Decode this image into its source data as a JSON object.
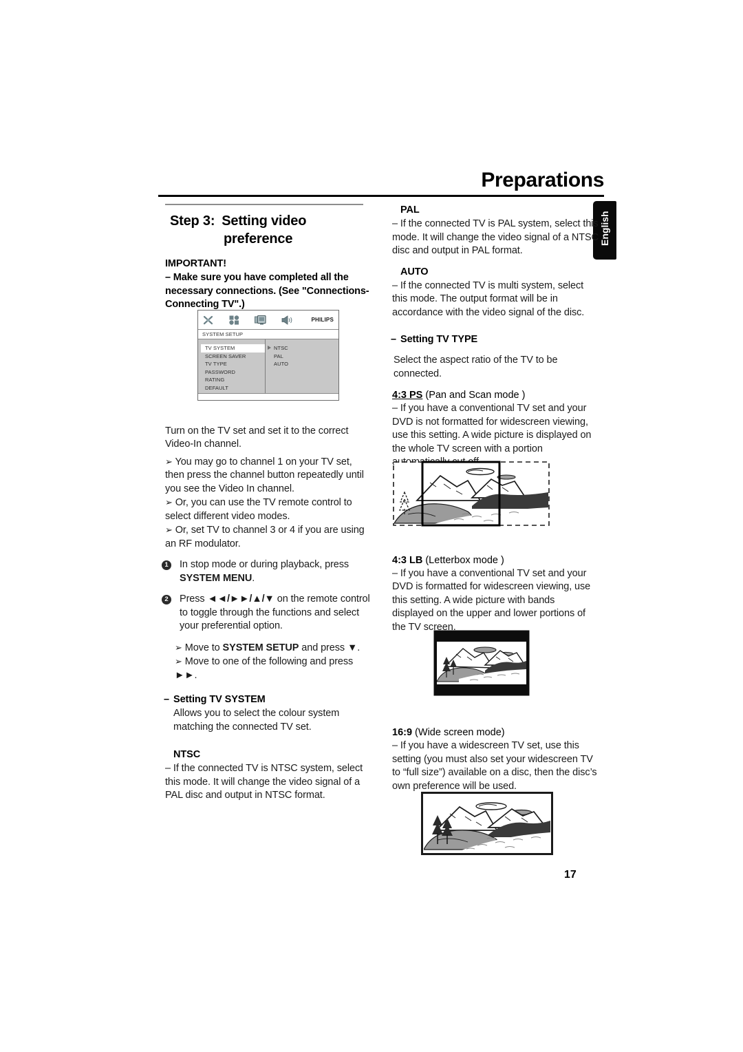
{
  "page": {
    "title": "Preparations",
    "language_tab": "English",
    "page_number": "17"
  },
  "left_column": {
    "step_label": "Step 3:",
    "step_title_line1": "Setting video",
    "step_title_line2": "preference",
    "important_heading": "IMPORTANT!",
    "important_text": "–  Make sure you have completed all the necessary connections. (See \"Connections-Connecting TV\".)",
    "intro_paragraph": "Turn on the TV set and set it to the correct Video-In channel.",
    "arrows": [
      "You may go to channel 1 on your TV set, then press the channel button repeatedly until you see the Video In channel.",
      "Or, you can use the TV remote control to select different video modes.",
      "Or, set TV to channel 3 or 4 if you are using an RF modulator."
    ],
    "steps": [
      {
        "number": "1",
        "text_before": "In stop mode or during playback, press ",
        "bold": "SYSTEM MENU",
        "text_after": "."
      },
      {
        "number": "2",
        "text_before": "Press ",
        "keys": "◄◄/►►/▲/▼",
        "text_after": " on the remote control to toggle through the functions and select your preferential option."
      }
    ],
    "sub_arrows": [
      {
        "prefix": "Move to ",
        "bold": "SYSTEM SETUP",
        "suffix": " and press ▼."
      },
      {
        "prefix": "Move to one of the following and press ",
        "bold": "",
        "suffix": "►►."
      }
    ],
    "tv_system": {
      "heading": "Setting TV SYSTEM",
      "description": "Allows you to select the colour system matching the connected TV set.",
      "ntsc_heading": "NTSC",
      "ntsc_text": "–   If the connected TV is NTSC system, select this mode. It will change the video signal of a PAL disc and output in NTSC format."
    }
  },
  "right_column": {
    "pal_heading": "PAL",
    "pal_text": "–   If the connected TV is PAL system, select this mode. It will change the video signal of a NTSC disc and output in PAL format.",
    "auto_heading": "AUTO",
    "auto_text": "–   If the connected TV is multi system, select this mode. The output format will be in accordance with the video signal of the disc.",
    "tv_type": {
      "heading": "Setting TV TYPE",
      "description": "Select the aspect ratio of the TV to be connected.",
      "modes": [
        {
          "label": "4:3 PS",
          "label_suffix": " (Pan and Scan mode )",
          "underline": true,
          "text": "–   If you have a conventional TV set and your DVD is not formatted for widescreen viewing, use this setting.  A wide picture is displayed on the whole TV screen with a portion automatically cut off."
        },
        {
          "label": "4:3 LB",
          "label_suffix": " (Letterbox mode )",
          "underline": false,
          "text": "–   If you have a conventional TV set and your DVD is formatted for widescreen viewing, use this setting.  A wide picture with bands displayed on the upper and lower portions of the TV screen."
        },
        {
          "label": "16:9",
          "label_suffix": " (Wide screen mode)",
          "underline": false,
          "text": "–   If you have a widescreen TV set, use this setting (you must also set your widescreen TV to “full size”) available on a disc, then the disc’s own preference will be used."
        }
      ]
    }
  },
  "osd_menu": {
    "icons": [
      "tools-icon",
      "preferences-icon",
      "video-display-icon",
      "audio-speaker-icon"
    ],
    "brand": "PHILIPS",
    "title": "SYSTEM SETUP",
    "items": [
      "TV SYSTEM",
      "SCREEN SAVER",
      "TV TYPE",
      "PASSWORD",
      "RATING",
      "DEFAULT"
    ],
    "selected_item": "TV SYSTEM",
    "options": [
      "NTSC",
      "PAL",
      "AUTO"
    ]
  },
  "illustrations": [
    {
      "name": "pan-and-scan-diagram",
      "caption": ""
    },
    {
      "name": "letterbox-diagram",
      "caption": ""
    },
    {
      "name": "widescreen-diagram",
      "caption": ""
    }
  ],
  "colors": {
    "rule": "#000000",
    "step_rule": "#8d8d8d",
    "osd_background": "#c8c8c8",
    "tab_background": "#0a0a0a",
    "body_text": "#1b1b1b"
  }
}
